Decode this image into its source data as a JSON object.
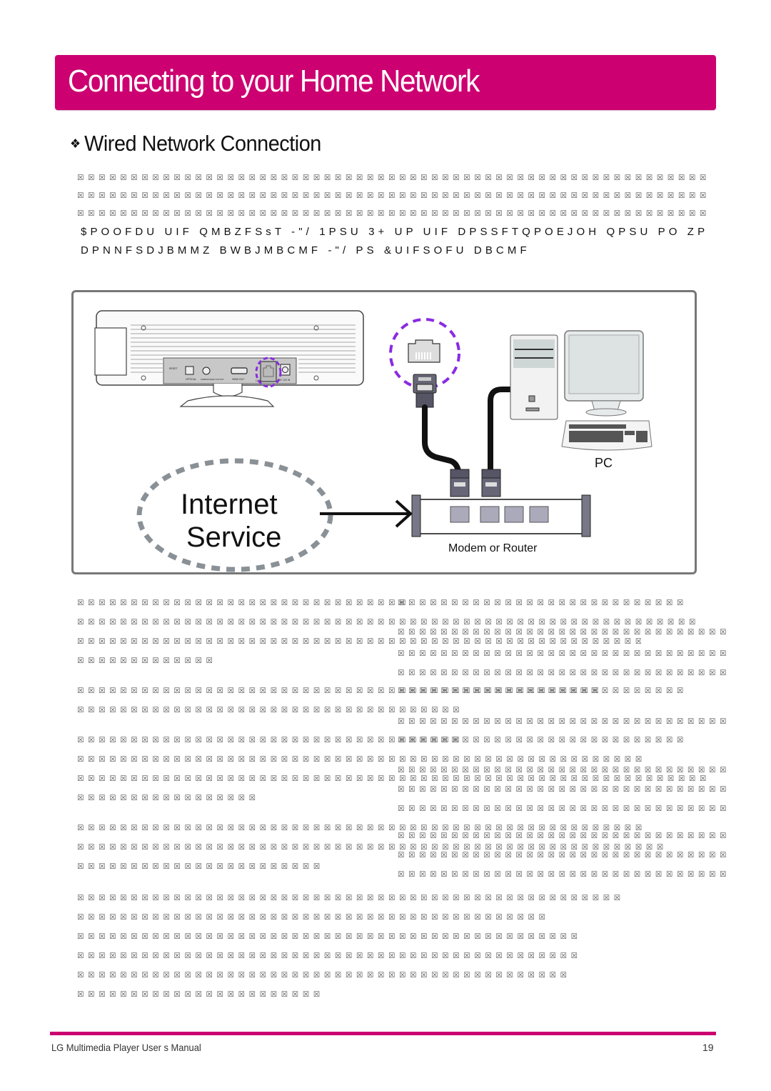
{
  "page": {
    "title": "Connecting to your Home Network",
    "section_heading": "Wired Network Connection",
    "section_bullet": "❖",
    "brand_color": "#cc0070",
    "accent_dashes_color": "#8a2be2"
  },
  "intro": {
    "missing_glyph_lines": [
      "☒☒☒☒☒☒☒☒☒☒☒☒☒☒☒☒☒☒☒☒☒☒☒☒☒☒☒☒☒☒☒☒☒☒☒☒☒☒☒☒☒☒☒☒☒☒☒☒☒☒☒☒☒☒☒☒☒☒☒",
      "☒☒☒☒☒☒☒☒☒☒☒☒☒☒☒☒☒☒☒☒☒☒☒☒☒☒☒☒☒☒☒☒☒☒☒☒☒☒☒☒☒☒☒☒☒☒☒☒☒☒☒☒☒☒☒☒☒☒☒",
      "☒☒☒☒☒☒☒☒☒☒☒☒☒☒☒☒☒☒☒☒☒☒☒☒☒☒☒☒☒☒☒☒☒☒☒☒☒☒☒☒☒☒☒☒☒☒☒☒☒☒☒☒☒☒☒☒☒☒☒"
    ],
    "encoded_lines": [
      "$POOFDU UIF QMBZFSsT -\"/ 1PSU 3+     UP UIF DPSSFTQPOEJOH QPSU PO ZP",
      "DPNNFSDJBMMZ BWBJMBCMF -\"/ PS &UIFSOFU DBCMF"
    ]
  },
  "diagram": {
    "pc_label": "PC",
    "internet_label_line1": "Internet",
    "internet_label_line2": "Service",
    "router_label": "Modem or Router",
    "player_port_labels": [
      "RESET",
      "OPTICAL",
      "SUBWOOFER OUTPUT",
      "HDMI OUT",
      "LAN",
      "DC 12V IN"
    ]
  },
  "body": {
    "left_col": [
      "☒☒☒☒☒☒☒☒☒☒☒☒☒☒☒☒☒☒☒☒☒☒☒☒☒☒☒☒☒☒☒",
      "☒☒☒☒☒☒☒☒☒☒☒☒☒☒☒☒☒☒☒☒☒☒☒☒☒☒☒☒☒☒☒☒☒☒☒☒☒☒☒☒☒☒☒☒☒☒☒☒☒☒☒☒☒☒☒☒☒☒",
      "☒☒☒☒☒☒☒☒☒☒☒☒☒☒☒☒☒☒☒☒☒☒☒☒☒☒☒☒☒☒☒☒☒☒☒☒☒☒☒☒☒☒☒☒☒☒☒☒☒☒☒☒☒☒",
      "☒☒☒☒☒☒☒☒☒☒☒☒☒",
      "☒☒☒☒☒☒☒☒☒☒☒☒☒☒☒☒☒☒☒☒☒☒☒☒☒☒☒☒☒☒☒☒☒☒☒☒☒☒☒☒☒☒☒☒☒☒☒☒☒☒☒☒☒☒",
      "☒☒☒☒☒☒☒☒☒☒☒☒☒☒☒☒☒☒☒☒☒☒☒☒☒☒☒☒☒☒☒☒☒☒☒☒☒☒",
      "☒☒☒☒☒☒☒☒☒☒☒☒☒☒☒☒☒☒☒☒☒☒☒☒☒☒☒☒☒☒☒☒☒☒☒☒☒☒☒☒☒☒☒☒☒☒☒",
      "☒☒☒☒☒☒☒☒☒☒☒☒☒☒☒☒☒☒☒☒☒☒☒☒☒☒☒☒☒☒☒☒☒☒☒☒☒☒☒☒☒☒☒☒☒☒☒☒☒☒☒☒☒",
      "☒☒☒☒☒☒☒☒☒☒☒☒☒☒☒☒☒☒☒☒☒☒☒☒☒☒☒☒☒☒☒☒☒☒☒☒☒☒☒☒☒☒☒☒☒☒☒☒☒☒☒☒☒☒☒☒☒☒☒",
      "☒☒☒☒☒☒☒☒☒☒☒☒☒☒☒☒☒",
      "☒☒☒☒☒☒☒☒☒☒☒☒☒☒☒☒☒☒☒☒☒☒☒☒☒☒☒☒☒☒☒☒☒☒☒☒☒☒☒☒☒☒☒☒☒☒☒☒☒☒☒☒☒",
      "☒☒☒☒☒☒☒☒☒☒☒☒☒☒☒☒☒☒☒☒☒☒☒☒☒☒☒☒☒☒☒☒☒☒☒☒☒☒☒☒☒☒☒☒☒☒☒☒☒☒☒☒☒☒☒",
      "☒☒☒☒☒☒☒☒☒☒☒☒☒☒☒☒☒☒☒☒☒☒☒"
    ],
    "right_col": [
      "☒☒☒☒☒☒☒☒☒☒☒☒☒☒☒☒☒☒☒☒☒☒☒☒☒☒☒",
      "☒☒☒☒☒☒☒☒☒☒☒☒☒☒☒☒☒☒☒☒☒☒☒☒☒☒☒☒☒☒☒",
      "☒☒☒☒☒☒☒☒☒☒☒☒☒☒☒☒☒☒☒☒☒☒☒☒☒☒☒☒☒☒☒",
      "☒☒☒☒☒☒☒☒☒☒☒☒☒☒☒☒☒☒☒☒☒☒☒☒☒☒☒☒☒☒☒",
      "☒☒☒☒☒☒☒☒☒☒☒☒☒☒☒☒☒☒☒☒☒☒☒☒☒☒☒☒☒",
      "☒☒☒☒☒☒☒☒☒☒☒☒☒☒☒☒☒☒☒☒☒☒☒☒☒☒☒☒☒☒☒",
      "☒☒☒☒☒☒☒☒☒☒☒☒☒☒☒☒☒☒☒☒☒☒☒☒☒☒☒☒☒",
      "☒☒☒☒☒☒☒☒☒☒☒☒☒☒☒☒☒☒☒☒☒☒☒☒☒☒☒☒☒☒☒",
      "☒☒☒☒☒☒☒☒☒☒☒☒☒☒☒☒☒☒☒☒☒☒☒☒☒☒☒☒☒☒☒",
      "☒☒☒☒☒☒☒☒☒☒☒☒☒☒☒☒☒☒☒☒☒☒☒☒☒☒☒☒☒☒☒",
      "☒☒☒☒☒☒☒☒☒☒☒☒☒☒☒☒☒☒☒☒☒☒☒☒☒☒☒☒☒☒☒",
      "☒☒☒☒☒☒☒☒☒☒☒☒☒☒☒☒☒☒☒☒☒☒☒☒☒☒☒☒☒☒☒",
      "☒☒☒☒☒☒☒☒☒☒☒☒☒☒☒☒☒☒☒☒☒☒☒☒☒☒☒☒☒☒☒"
    ],
    "bottom_paragraph": [
      "☒☒☒☒☒☒☒☒☒☒☒☒☒☒☒☒☒☒☒☒☒☒☒☒☒☒☒☒☒☒☒☒☒☒☒☒☒☒☒☒☒☒☒☒☒☒☒☒☒☒☒",
      "☒☒☒☒☒☒☒☒☒☒☒☒☒☒☒☒☒☒☒☒☒☒☒☒☒☒☒☒☒☒☒☒☒☒☒☒☒☒☒☒☒☒☒☒",
      "☒☒☒☒☒☒☒☒☒☒☒☒☒☒☒☒☒☒☒☒☒☒☒☒☒☒☒☒☒☒☒☒☒☒☒☒☒☒☒☒☒☒☒☒☒☒☒",
      "☒☒☒☒☒☒☒☒☒☒☒☒☒☒☒☒☒☒☒☒☒☒☒☒☒☒☒☒☒☒☒☒☒☒☒☒☒☒☒☒☒☒☒☒☒☒☒",
      "☒☒☒☒☒☒☒☒☒☒☒☒☒☒☒☒☒☒☒☒☒☒☒☒☒☒☒☒☒☒☒☒☒☒☒☒☒☒☒☒☒☒☒☒☒☒",
      "☒☒☒☒☒☒☒☒☒☒☒☒☒☒☒☒☒☒☒☒☒☒☒"
    ]
  },
  "footer": {
    "manual_title": "LG Multimedia Player User s Manual",
    "page_number": "19"
  }
}
